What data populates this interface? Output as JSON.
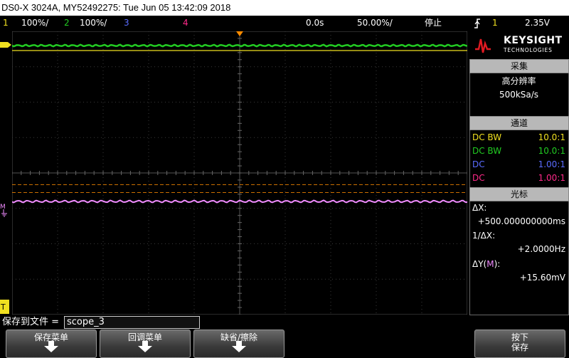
{
  "title": "DS0-X 3024A, MY52492275: Tue Jun 05 13:42:09 2018",
  "status": {
    "ch1": {
      "num": "1",
      "scale": "100%/"
    },
    "ch2": {
      "num": "2",
      "scale": "100%/"
    },
    "ch3": {
      "num": "3"
    },
    "ch4": {
      "num": "4"
    },
    "delay": "0.0s",
    "timebase": "50.00%/",
    "run_state": "停止",
    "trigger_icon": "trigger-edge-icon",
    "trigger_source": "1",
    "trigger_level": "2.35V"
  },
  "brand": {
    "name": "KEYSIGHT",
    "sub": "TECHNOLOGIES"
  },
  "acquire": {
    "header": "采集",
    "mode": "高分辨率",
    "rate": "500kSa/s"
  },
  "channels": {
    "header": "通道",
    "rows": [
      {
        "left": "DC BW",
        "right": "10.0:1",
        "color": "#f0e020"
      },
      {
        "left": "DC BW",
        "right": "10.0:1",
        "color": "#22cc22"
      },
      {
        "left": "DC",
        "right": "1.00:1",
        "color": "#5a6cff"
      },
      {
        "left": "DC",
        "right": "1.00:1",
        "color": "#ff2a8a"
      }
    ]
  },
  "cursors": {
    "header": "光标",
    "dx_label": "ΔX:",
    "dx_value": "+500.000000000ms",
    "inv_label": "1/ΔX:",
    "inv_value": "+2.0000Hz",
    "dy_label_prefix": "ΔY(",
    "dy_label_m": "M",
    "dy_label_suffix": "):",
    "dy_value": "+15.60mV"
  },
  "save": {
    "label": "保存到文件 =",
    "filename": "scope_3"
  },
  "softkeys": [
    {
      "label": "保存菜单"
    },
    {
      "label": "回调菜单"
    },
    {
      "label": "缺省/擦除"
    },
    {
      "label_line1": "按下",
      "label_line2": "保存"
    }
  ],
  "colors": {
    "ch1": "#f0e020",
    "ch2": "#22cc22",
    "ch3": "#5a6cff",
    "ch4": "#ff2a8a",
    "math": "#f08cff",
    "trigger": "#ff8c00"
  }
}
